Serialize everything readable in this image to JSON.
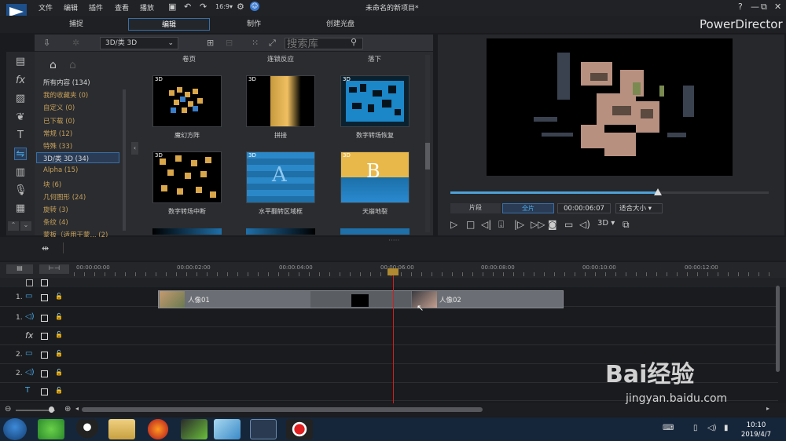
{
  "menu": [
    "文件",
    "编辑",
    "插件",
    "查看",
    "播放"
  ],
  "window_title": "未命名的新项目*",
  "window_controls": [
    "?",
    "—",
    "⧉",
    "✕"
  ],
  "modes": [
    "捕捉",
    "编辑",
    "制作",
    "创建光盘"
  ],
  "brand": "PowerDirector",
  "library": {
    "category_dropdown": "3D/类 3D",
    "search_placeholder": "搜索库",
    "categories": [
      {
        "label": "所有内容 (134)",
        "color": "white"
      },
      {
        "label": "我的收藏夹 (0)",
        "color": "orange"
      },
      {
        "label": "自定义 (0)",
        "color": "orange"
      },
      {
        "label": "已下载 (0)",
        "color": "orange"
      },
      {
        "label": "常规 (12)",
        "color": "orange"
      },
      {
        "label": "特殊 (33)",
        "color": "orange"
      },
      {
        "label": "3D/类 3D (34)",
        "color": "white",
        "selected": true
      },
      {
        "label": "Alpha (15)",
        "color": "orange"
      },
      {
        "label": "块 (6)",
        "color": "orange"
      },
      {
        "label": "几何图形 (24)",
        "color": "orange"
      },
      {
        "label": "旋转 (3)",
        "color": "orange"
      },
      {
        "label": "条纹 (4)",
        "color": "orange"
      },
      {
        "label": "蒙板（适用于蒙... (2)",
        "color": "orange"
      }
    ],
    "column_headers": [
      "卷页",
      "连锁反应",
      "落下"
    ],
    "items": [
      {
        "label": "魔幻方阵",
        "badge": "3D"
      },
      {
        "label": "拼接",
        "badge": "3D"
      },
      {
        "label": "数字转场恢复",
        "badge": "3D"
      },
      {
        "label": "数字转场中断",
        "badge": "3D"
      },
      {
        "label": "水平翻转区域框",
        "badge": "3D"
      },
      {
        "label": "天崩地裂",
        "badge": "3D"
      }
    ]
  },
  "preview": {
    "tab_clip": "片段",
    "tab_full": "全片",
    "timecode": "00:00:06:07",
    "fit": "适合大小",
    "mode_3d": "3D",
    "progress": 0.65
  },
  "timeline": {
    "ruler": [
      "00:00:00:00",
      "00:00:02:00",
      "00:00:04:00",
      "00:00:06:00",
      "00:00:08:00",
      "00:00:10:00",
      "00:00:12:00"
    ],
    "tracks": [
      {
        "label": "1.",
        "type": "video"
      },
      {
        "label": "1.",
        "type": "audio"
      },
      {
        "label": "",
        "type": "fx"
      },
      {
        "label": "2.",
        "type": "video"
      },
      {
        "label": "2.",
        "type": "audio"
      },
      {
        "label": "",
        "type": "title"
      }
    ],
    "clips": {
      "clip1": "人像01",
      "clip2": "人像02"
    }
  },
  "taskbar": {
    "time": "10:10",
    "date": "2019/4/7"
  },
  "watermark": {
    "line1": "Bai经验",
    "line2": "jingyan.baidu.com"
  }
}
